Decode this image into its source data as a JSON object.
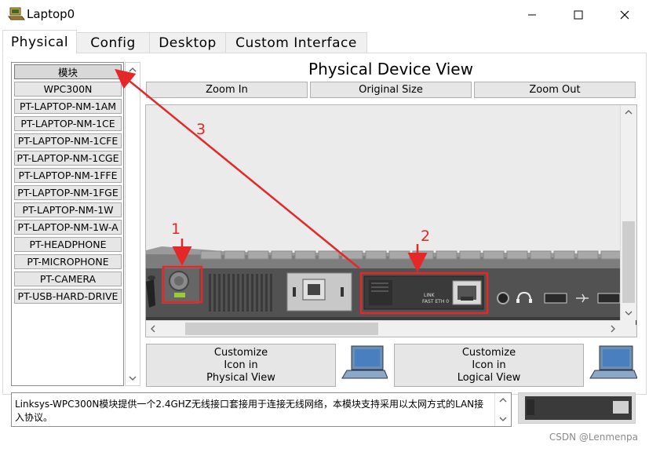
{
  "window": {
    "title": "Laptop0"
  },
  "tabs": [
    {
      "label": "Physical",
      "active": true
    },
    {
      "label": "Config",
      "active": false
    },
    {
      "label": "Desktop",
      "active": false
    },
    {
      "label": "Custom Interface",
      "active": false
    }
  ],
  "modules": {
    "items": [
      "模块",
      "WPC300N",
      "PT-LAPTOP-NM-1AM",
      "PT-LAPTOP-NM-1CE",
      "PT-LAPTOP-NM-1CFE",
      "PT-LAPTOP-NM-1CGE",
      "PT-LAPTOP-NM-1FFE",
      "PT-LAPTOP-NM-1FGE",
      "PT-LAPTOP-NM-1W",
      "PT-LAPTOP-NM-1W-A",
      "PT-HEADPHONE",
      "PT-MICROPHONE",
      "PT-CAMERA",
      "PT-USB-HARD-DRIVE"
    ]
  },
  "device_view": {
    "title": "Physical Device View",
    "zoom_in": "Zoom In",
    "original_size": "Original Size",
    "zoom_out": "Zoom Out",
    "port_label_link": "LINK",
    "port_label_fast_eth": "FAST ETH 0"
  },
  "customize": {
    "physical": {
      "line1": "Customize",
      "line2": "Icon in",
      "line3": "Physical View"
    },
    "logical": {
      "line1": "Customize",
      "line2": "Icon in",
      "line3": "Logical View"
    }
  },
  "description": {
    "text": "Linksys-WPC300N模块提供一个2.4GHZ无线接口套接用于连接无线网络，本模块支持采用以太网方式的LAN接入协议。"
  },
  "annotations": {
    "one": "1",
    "two": "2",
    "three": "3",
    "color": "#e52727"
  },
  "watermark": "CSDN @Lenmenpa"
}
